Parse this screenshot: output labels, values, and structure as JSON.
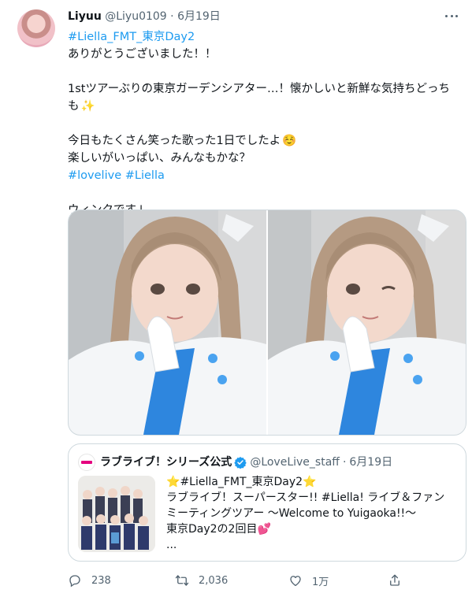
{
  "tweet": {
    "display_name": "Liyuu",
    "handle": "@Liyu0109",
    "separator": "·",
    "date": "6月19日",
    "hashtag_top": "#Liella_FMT_東京Day2",
    "line1": "ありがとうございました！！",
    "line2a": "1stツアーぶりの東京ガーデンシアター…！懐かしいと新鮮な気持ちどっち",
    "line2b": "も",
    "line2b_emoji": "✨",
    "line3": "今日もたくさん笑った歌った1日でしたよ",
    "line3_emoji": "☺️",
    "line4": "楽しいがいっぱい、みんなもかな？",
    "hashtag_1": "#lovelive",
    "hashtag_2": "#Liella",
    "line5": "ウィンクです↓"
  },
  "quote": {
    "display_name": "ラブライブ！シリーズ公式",
    "handle": "@LoveLive_staff",
    "separator": "·",
    "date": "6月19日",
    "star_emoji": "⭐",
    "hashtag": "#Liella_FMT_東京Day2",
    "line1": "ラブライブ！スーパースター!! #Liella! ライブ＆ファン",
    "line2": "ミーティングツアー ～Welcome to Yuigaoka!!～",
    "line3": "東京Day2の2回目",
    "line3_emoji": "💕",
    "line4": "..."
  },
  "actions": {
    "replies": "238",
    "retweets": "2,036",
    "likes": "1万"
  },
  "icons": {
    "more": "more-horizontal-icon",
    "reply": "reply-icon",
    "retweet": "retweet-icon",
    "like": "heart-icon",
    "share": "share-icon",
    "verified": "verified-badge-icon"
  },
  "colors": {
    "link": "#1d9bf0",
    "secondary_text": "#536471",
    "border": "#cfd9de",
    "uniform_blue": "#2e86de"
  }
}
